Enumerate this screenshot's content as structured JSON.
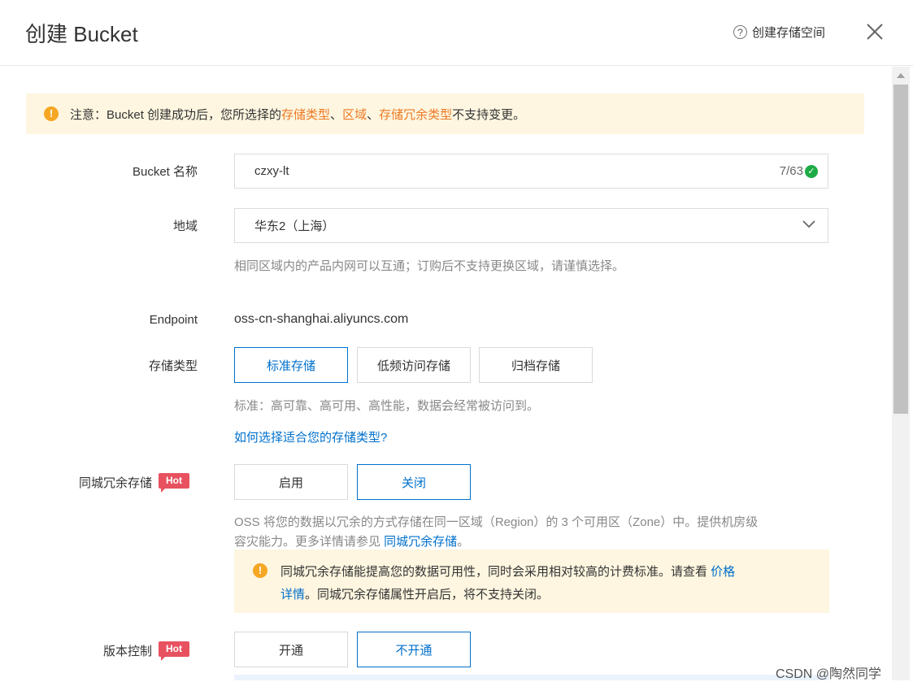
{
  "header": {
    "title": "创建 Bucket",
    "help_label": "创建存储空间"
  },
  "notice": {
    "prefix": "注意：Bucket 创建成功后，您所选择的 ",
    "hl1": "存储类型",
    "sep1": "、",
    "hl2": "区域",
    "sep2": "、",
    "hl3": "存储冗余类型",
    "suffix": " 不支持变更。"
  },
  "form": {
    "bucket_name": {
      "label": "Bucket 名称",
      "value": "czxy-lt",
      "counter": "7/63"
    },
    "region": {
      "label": "地域",
      "value": "华东2（上海）",
      "hint": "相同区域内的产品内网可以互通；订购后不支持更换区域，请谨慎选择。"
    },
    "endpoint": {
      "label": "Endpoint",
      "value": "oss-cn-shanghai.aliyuncs.com"
    },
    "storage_type": {
      "label": "存储类型",
      "options": [
        "标准存储",
        "低频访问存储",
        "归档存储"
      ],
      "selected": "标准存储",
      "hint": "标准：高可靠、高可用、高性能，数据会经常被访问到。",
      "link": "如何选择适合您的存储类型?"
    },
    "redundancy": {
      "label": "同城冗余存储",
      "badge": "Hot",
      "options": [
        "启用",
        "关闭"
      ],
      "selected": "关闭",
      "desc_line1": "OSS 将您的数据以冗余的方式存储在同一区域（Region）的 3 个可用区（Zone）中。提供机房级",
      "desc_line2": "容灾能力。更多详情请参见 ",
      "desc_link": "同城冗余存储",
      "desc_end": "。",
      "warn_line1": "同城冗余存储能提高您的数据可用性，同时会采用相对较高的计费标准。请查看 ",
      "warn_link_a": "价格",
      "warn_link_b": "详情",
      "warn_line2": "。同城冗余存储属性开启后，将不支持关闭。"
    },
    "versioning": {
      "label": "版本控制",
      "badge": "Hot",
      "options": [
        "开通",
        "不开通"
      ],
      "selected": "不开通"
    }
  },
  "watermark": "CSDN @陶然同学",
  "colors": {
    "accent": "#0070cc",
    "warning": "#f5a623",
    "highlight": "#ec7a25",
    "hot": "#e8515f",
    "success": "#1eab45"
  }
}
